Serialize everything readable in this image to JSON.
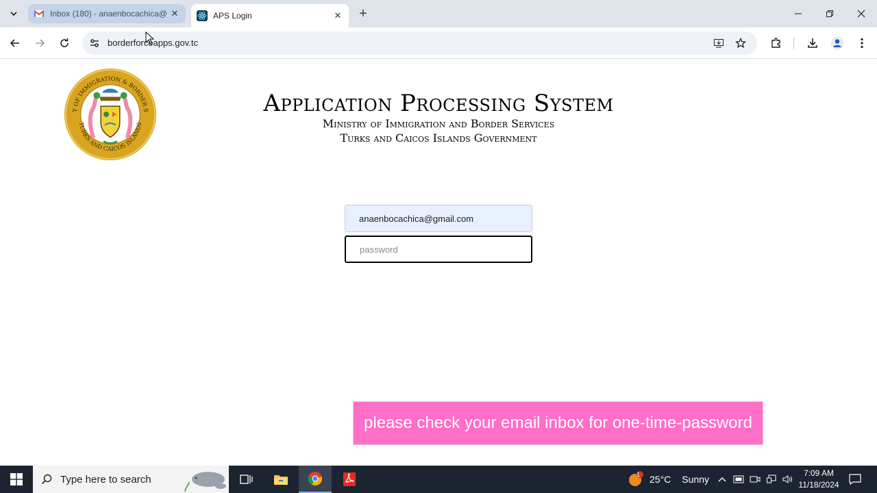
{
  "browser": {
    "tabs": [
      {
        "title": "Inbox (180) - anaenbocachica@",
        "icon": "gmail-icon"
      },
      {
        "title": "APS Login",
        "icon": "react-icon"
      }
    ],
    "url": "borderforceapps.gov.tc"
  },
  "page": {
    "title": "Application Processing System",
    "subtitle1": "Ministry of Immigration and Border Services",
    "subtitle2": "Turks and Caicos Islands Government",
    "seal_text_top": "MINISTRY OF IMMIGRATION & BORDER SERVICES",
    "seal_text_bottom": "TURKS AND CAICOS ISLANDS",
    "email_value": "anaenbocachica@gmail.com",
    "password_placeholder": "password",
    "toast": "please check your email inbox for one-time-password"
  },
  "taskbar": {
    "search_placeholder": "Type here to search",
    "weather_temp": "25°C",
    "weather_desc": "Sunny",
    "weather_badge": "1",
    "time": "7:09 AM",
    "date": "11/18/2024"
  },
  "colors": {
    "toast_bg": "#ff6ec7",
    "seal_gold": "#d9a521",
    "taskbar_bg": "#1c2331"
  }
}
